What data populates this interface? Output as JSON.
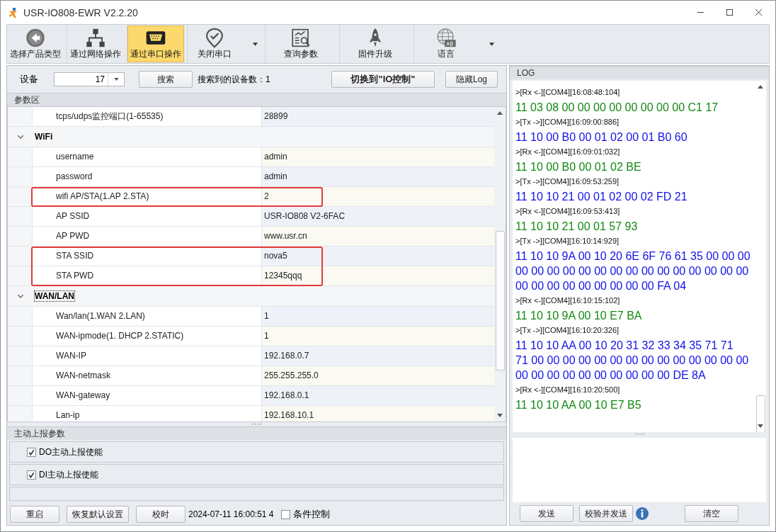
{
  "window": {
    "title": "USR-IO808-EWR V2.2.20"
  },
  "toolbar": [
    {
      "label": "选择产品类型",
      "selected": false,
      "dropdown": false
    },
    {
      "label": "通过网络操作",
      "selected": false,
      "dropdown": false
    },
    {
      "label": "通过串口操作",
      "selected": true,
      "dropdown": false
    },
    {
      "label": "关闭串口",
      "selected": false,
      "dropdown": true
    },
    {
      "label": "查询参数",
      "selected": false,
      "dropdown": false
    },
    {
      "label": "固件升级",
      "selected": false,
      "dropdown": false
    },
    {
      "label": "语言",
      "selected": false,
      "dropdown": true
    }
  ],
  "device_bar": {
    "label": "设备",
    "device": "17",
    "search_button": "搜索",
    "found_label": "搜索到的设备数：",
    "found_count": "1",
    "switch_button": "切换到\"IO控制\"",
    "hide_log_button": "隐藏Log"
  },
  "params": {
    "title": "参数区",
    "sections": [
      {
        "rows": [
          {
            "label": "tcps/udps监控端口(1-65535)",
            "value": "28899",
            "highlighted": false
          }
        ]
      },
      {
        "title": "WiFi",
        "expanded": true,
        "focused": false,
        "rows": [
          {
            "label": "username",
            "value": "admin",
            "highlighted": false
          },
          {
            "label": "password",
            "value": "admin",
            "highlighted": false
          },
          {
            "label": "wifi AP/STA(1.AP 2.STA)",
            "value": "2",
            "highlighted": true
          },
          {
            "label": "AP SSID",
            "value": "USR-IO808 V2-6FAC",
            "highlighted": false
          },
          {
            "label": "AP PWD",
            "value": "www.usr.cn",
            "highlighted": false
          },
          {
            "label": "STA SSID",
            "value": "nova5",
            "highlighted": true
          },
          {
            "label": "STA PWD",
            "value": "12345qqq",
            "highlighted": true
          }
        ]
      },
      {
        "title": "WAN/LAN",
        "expanded": true,
        "focused": true,
        "rows": [
          {
            "label": "Wan/lan(1.WAN 2.LAN)",
            "value": "1",
            "highlighted": false
          },
          {
            "label": "WAN-ipmode(1. DHCP 2.STATIC)",
            "value": "1",
            "highlighted": false
          },
          {
            "label": "WAN-IP",
            "value": "192.168.0.7",
            "highlighted": false
          },
          {
            "label": "WAN-netmask",
            "value": "255.255.255.0",
            "highlighted": false
          },
          {
            "label": "WAN-gateway",
            "value": "192.168.0.1",
            "highlighted": false
          },
          {
            "label": "Lan-ip",
            "value": "192.168.10.1",
            "highlighted": false
          }
        ]
      }
    ]
  },
  "report": {
    "title": "主动上报参数",
    "options": [
      {
        "label": "DO主动上报使能",
        "checked": true
      },
      {
        "label": "DI主动上报使能",
        "checked": true
      }
    ]
  },
  "bottom_bar": {
    "buttons": [
      "重启",
      "恢复默认设置",
      "校时"
    ],
    "timestamp": "2024-07-11 16:00:51 4",
    "condition": {
      "label": "条件控制",
      "checked": false
    }
  },
  "log": {
    "title": "LOG",
    "entries": [
      {
        "kind": "rx",
        "header": ">[Rx <-][COM4][16:08:48:104]",
        "lines": [
          "11 03 08 00 00 00 00 00 00 00 00 C1 17"
        ]
      },
      {
        "kind": "tx",
        "header": ">[Tx ->][COM4][16:09:00:886]",
        "lines": [
          "11 10 00 B0 00 01 02 00 01 B0 60"
        ]
      },
      {
        "kind": "rx",
        "header": ">[Rx <-][COM4][16:09:01:032]",
        "lines": [
          "11 10 00 B0 00 01 02 BE"
        ]
      },
      {
        "kind": "tx",
        "header": ">[Tx ->][COM4][16:09:53:259]",
        "lines": [
          "11 10 10 21 00 01 02 00 02 FD 21"
        ]
      },
      {
        "kind": "rx",
        "header": ">[Rx <-][COM4][16:09:53:413]",
        "lines": [
          "11 10 10 21 00 01 57 93"
        ]
      },
      {
        "kind": "tx",
        "header": ">[Tx ->][COM4][16:10:14:929]",
        "lines": [
          "11 10 10 9A 00 10 20 6E 6F 76 61 35 00 00 00",
          "00 00 00 00 00 00 00 00 00 00 00 00 00 00 00",
          "00 00 00 00 00 00 00 00 00 FA 04"
        ]
      },
      {
        "kind": "rx",
        "header": ">[Rx <-][COM4][16:10:15:102]",
        "lines": [
          "11 10 10 9A 00 10 E7 BA"
        ]
      },
      {
        "kind": "tx",
        "header": ">[Tx ->][COM4][16:10:20:326]",
        "lines": [
          "11 10 10 AA 00 10 20 31 32 33 34 35 71 71",
          "71 00 00 00 00 00 00 00 00 00 00 00 00 00 00",
          "00 00 00 00 00 00 00 00 00 00 DE 8A"
        ]
      },
      {
        "kind": "rx",
        "header": ">[Rx <-][COM4][16:10:20:500]",
        "lines": [
          "11 10 10 AA 00 10 E7 B5"
        ]
      }
    ],
    "send_button": "发送",
    "check_send_button": "校验并发送",
    "clear_button": "清空"
  }
}
